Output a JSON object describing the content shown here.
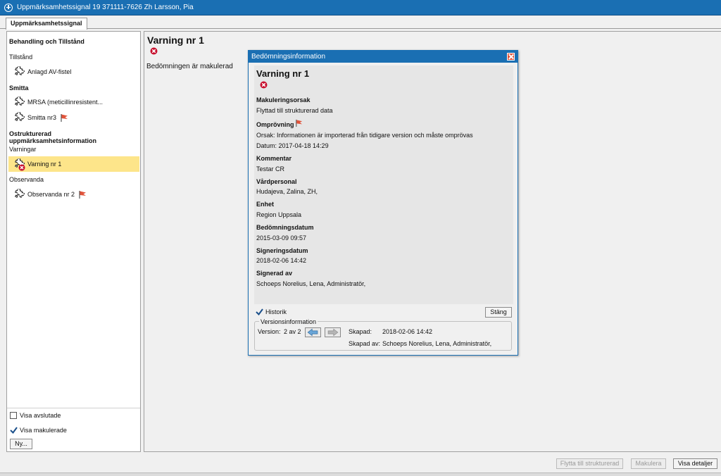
{
  "window": {
    "title": "Uppmärksamhetssignal 19 371111-7626 Zh Larsson, Pia"
  },
  "tabs": [
    {
      "label": "Uppmärksamhetssignal"
    }
  ],
  "sidebar": {
    "section1": "Behandling och Tillstånd",
    "tillstand_label": "Tillstånd",
    "item_av_fistel": "Anlagd AV-fistel",
    "smitta_label": "Smitta",
    "item_mrsa": "MRSA (meticillinresistent...",
    "item_smitta_nr3": "Smitta nr3",
    "section2": "Ostrukturerad uppmärksamhetsinformation",
    "varningar_label": "Varningar",
    "item_varning_nr1": "Varning nr 1",
    "observanda_label": "Observanda",
    "item_observanda_nr2": "Observanda nr 2",
    "show_finished": "Visa avslutade",
    "show_voided": "Visa makulerade",
    "new_button": "Ny..."
  },
  "main": {
    "title": "Varning nr 1",
    "subtitle": "Bedömningen är makulerad"
  },
  "dialog": {
    "title": "Bedömningsinformation",
    "heading": "Varning nr 1",
    "fields": {
      "makuleringsorsak_label": "Makuleringsorsak",
      "makuleringsorsak_value": "Flyttad till strukturerad data",
      "omprovning_label": "Omprövning",
      "omprovning_orsak": "Orsak: Informationen är importerad från tidigare version och måste omprövas",
      "omprovning_datum": "Datum: 2017-04-18 14:29",
      "kommentar_label": "Kommentar",
      "kommentar_value": "Testar CR",
      "vardpersonal_label": "Vårdpersonal",
      "vardpersonal_value": "Hudajeva, Zalina, ZH,",
      "enhet_label": "Enhet",
      "enhet_value": "Region Uppsala",
      "bedomningsdatum_label": "Bedömningsdatum",
      "bedomningsdatum_value": "2015-03-09 09:57",
      "signeringsdatum_label": "Signeringsdatum",
      "signeringsdatum_value": "2018-02-06 14:42",
      "signerad_av_label": "Signerad av",
      "signerad_av_value": "Schoeps Norelius, Lena, Administratör,"
    },
    "historik_label": "Historik",
    "close_button": "Stäng",
    "versions": {
      "legend": "Versionsinformation",
      "version_label": "Version:",
      "version_value": "2 av 2",
      "created_label": "Skapad:",
      "created_value": "2018-02-06 14:42",
      "created_by_label": "Skapad av:",
      "created_by_value": "Schoeps Norelius, Lena, Administratör,"
    }
  },
  "footer": {
    "move_button": "Flytta till strukturerad",
    "void_button": "Makulera",
    "details_button": "Visa detaljer"
  },
  "colors": {
    "titlebar": "#1a6fb3",
    "selection": "#fde58a",
    "flag": "#e0533a",
    "error": "#c8102e"
  }
}
